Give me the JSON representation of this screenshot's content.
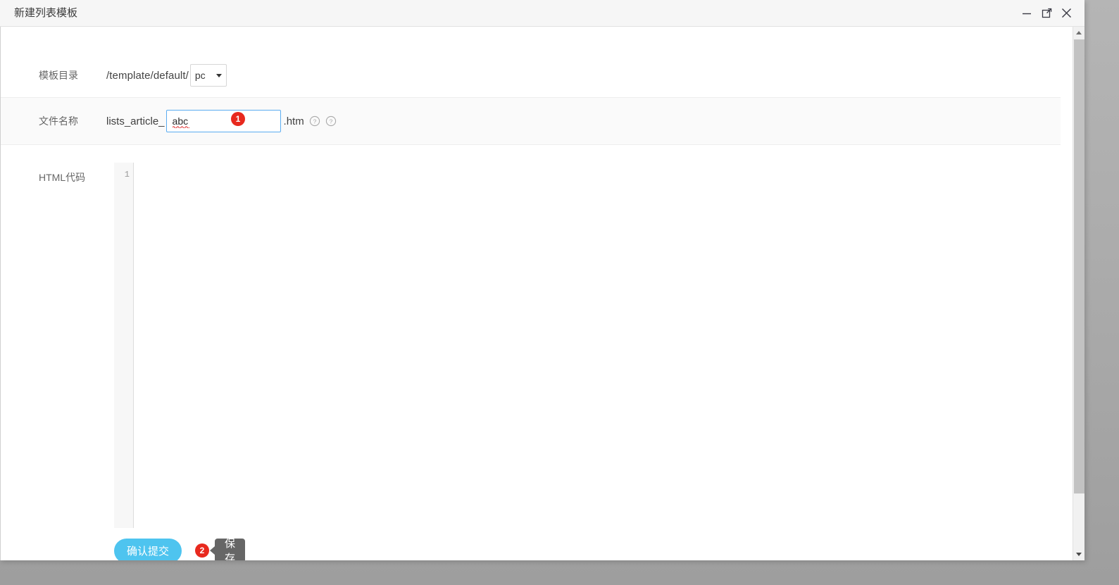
{
  "window": {
    "title": "新建列表模板",
    "controls": {
      "minimize": "minimize-icon",
      "maximize": "maximize-icon",
      "close": "close-icon"
    }
  },
  "form": {
    "rows": [
      {
        "label": "模板目录",
        "path_text": "/template/default/",
        "select_value": "pc",
        "select_options": [
          "pc"
        ]
      },
      {
        "label": "文件名称",
        "prefix": "lists_article_",
        "input_value": "abc",
        "input_placeholder": "",
        "suffix": ".htm",
        "help_icons": [
          "help-icon",
          "help-icon"
        ]
      },
      {
        "label": "HTML代码",
        "line_numbers": "1",
        "code_value": ""
      }
    ]
  },
  "footer": {
    "submit_label": "确认提交",
    "tooltip_label": "保存"
  },
  "badges": {
    "step_one": "1",
    "step_two": "2"
  },
  "scrollbar": {
    "up_arrow": "scroll-up-icon",
    "down_arrow": "scroll-down-icon"
  },
  "colors": {
    "accent": "#4ec4ef",
    "badge": "#e8291e",
    "tooltip": "#666666",
    "focus_border": "#5aacf0",
    "titlebar_bg": "#f6f6f6"
  }
}
